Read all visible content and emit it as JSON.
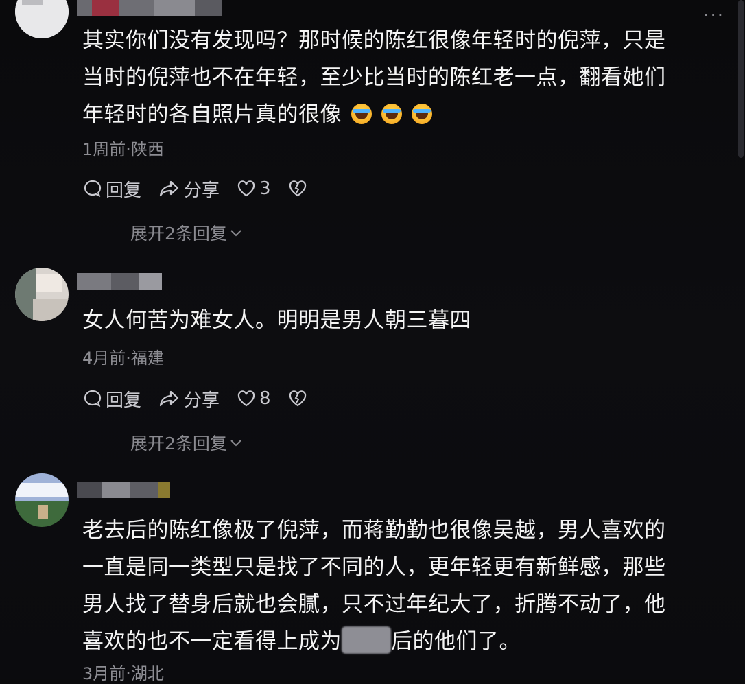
{
  "comments": [
    {
      "text_parts": [
        "其实你们没有发现吗？那时候的陈红很像年轻时的倪萍，只是",
        "当时的倪萍也不在年轻，至少比当时的陈红老一点，翻看她们",
        "年轻时的各自照片真的很像"
      ],
      "emojis": [
        "laugh-cry-emoji",
        "laugh-cry-emoji",
        "laugh-cry-emoji"
      ],
      "meta": "1周前·陕西",
      "reply_label": "回复",
      "share_label": "分享",
      "like_count": "3",
      "expand_label": "展开2条回复"
    },
    {
      "text_parts": [
        "女人何苦为难女人。明明是男人朝三暮四"
      ],
      "meta": "4月前·福建",
      "reply_label": "回复",
      "share_label": "分享",
      "like_count": "8",
      "expand_label": "展开2条回复"
    },
    {
      "text_parts": [
        "老去后的陈红像极了倪萍，而蒋勤勤也很像吴越，男人喜欢的",
        "一直是同一类型只是找了不同的人，更年轻更有新鲜感，那些",
        "男人找了替身后就也会腻，只不过年纪大了，折腾不动了，他",
        "喜欢的也不一定看得上成为",
        "后的他们了。"
      ],
      "meta": "3月前·湖北"
    }
  ],
  "colors": {
    "background": "#0b0b0d",
    "text": "#f4f4f4",
    "meta": "#8d8d93",
    "action": "#c9c9cf"
  }
}
